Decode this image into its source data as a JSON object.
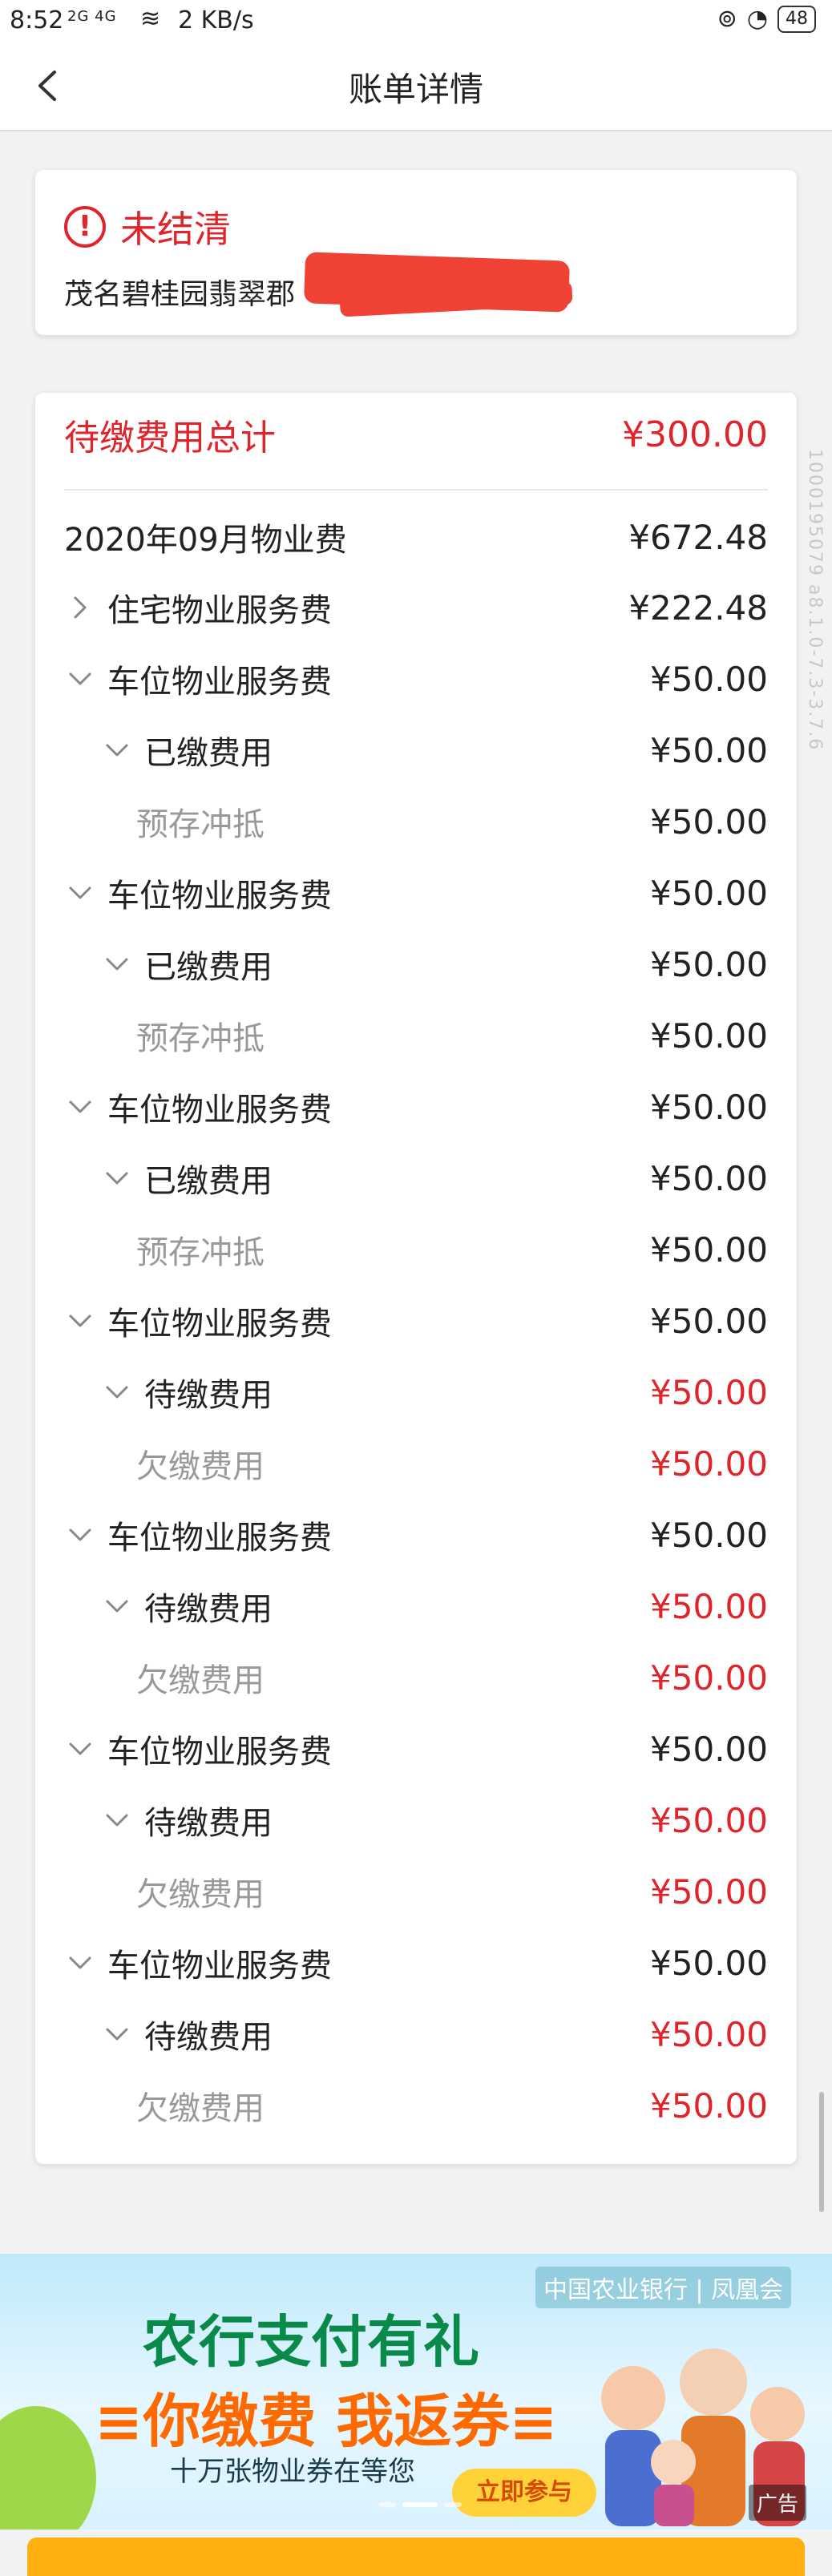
{
  "status_bar": {
    "time": "8:52",
    "signal": "2G 4G",
    "speed": "2 KB/s",
    "battery": "48"
  },
  "nav": {
    "title": "账单详情"
  },
  "status_card": {
    "status": "未结清",
    "address": "茂名碧桂园翡翠郡"
  },
  "fees": {
    "total_label": "待缴费用总计",
    "total_amount": "¥300.00",
    "period_label": "2020年09月物业费",
    "period_amount": "¥672.48",
    "items": [
      {
        "label": "住宅物业服务费",
        "amount": "¥222.48",
        "level": 0,
        "expanded": false,
        "tone": "normal"
      },
      {
        "label": "车位物业服务费",
        "amount": "¥50.00",
        "level": 0,
        "expanded": true,
        "tone": "normal"
      },
      {
        "label": "已缴费用",
        "amount": "¥50.00",
        "level": 1,
        "expanded": true,
        "tone": "normal"
      },
      {
        "label": "预存冲抵",
        "amount": "¥50.00",
        "level": 2,
        "tone": "paid"
      },
      {
        "label": "车位物业服务费",
        "amount": "¥50.00",
        "level": 0,
        "expanded": true,
        "tone": "normal"
      },
      {
        "label": "已缴费用",
        "amount": "¥50.00",
        "level": 1,
        "expanded": true,
        "tone": "normal"
      },
      {
        "label": "预存冲抵",
        "amount": "¥50.00",
        "level": 2,
        "tone": "paid"
      },
      {
        "label": "车位物业服务费",
        "amount": "¥50.00",
        "level": 0,
        "expanded": true,
        "tone": "normal"
      },
      {
        "label": "已缴费用",
        "amount": "¥50.00",
        "level": 1,
        "expanded": true,
        "tone": "normal"
      },
      {
        "label": "预存冲抵",
        "amount": "¥50.00",
        "level": 2,
        "tone": "paid"
      },
      {
        "label": "车位物业服务费",
        "amount": "¥50.00",
        "level": 0,
        "expanded": true,
        "tone": "normal"
      },
      {
        "label": "待缴费用",
        "amount": "¥50.00",
        "level": 1,
        "expanded": true,
        "tone": "due"
      },
      {
        "label": "欠缴费用",
        "amount": "¥50.00",
        "level": 2,
        "tone": "due"
      },
      {
        "label": "车位物业服务费",
        "amount": "¥50.00",
        "level": 0,
        "expanded": true,
        "tone": "normal"
      },
      {
        "label": "待缴费用",
        "amount": "¥50.00",
        "level": 1,
        "expanded": true,
        "tone": "due"
      },
      {
        "label": "欠缴费用",
        "amount": "¥50.00",
        "level": 2,
        "tone": "due"
      },
      {
        "label": "车位物业服务费",
        "amount": "¥50.00",
        "level": 0,
        "expanded": true,
        "tone": "normal"
      },
      {
        "label": "待缴费用",
        "amount": "¥50.00",
        "level": 1,
        "expanded": true,
        "tone": "due"
      },
      {
        "label": "欠缴费用",
        "amount": "¥50.00",
        "level": 2,
        "tone": "due"
      },
      {
        "label": "车位物业服务费",
        "amount": "¥50.00",
        "level": 0,
        "expanded": true,
        "tone": "normal"
      },
      {
        "label": "待缴费用",
        "amount": "¥50.00",
        "level": 1,
        "expanded": true,
        "tone": "due"
      },
      {
        "label": "欠缴费用",
        "amount": "¥50.00",
        "level": 2,
        "tone": "due"
      }
    ]
  },
  "side_code": "1000195079 a8.1.0-7.3-3.7.6",
  "banner": {
    "bank": "中国农业银行 | 凤凰会",
    "line1": "农行支付有礼",
    "line2": "≡你缴费 我返券≡",
    "line3": "十万张物业券在等您",
    "button": "立即参与",
    "ad_tag": "广告"
  },
  "colors": {
    "red": "#e0242b",
    "grey": "#999999",
    "banner_btn": "#ffd23a",
    "bottom_bar": "#ffb010"
  }
}
